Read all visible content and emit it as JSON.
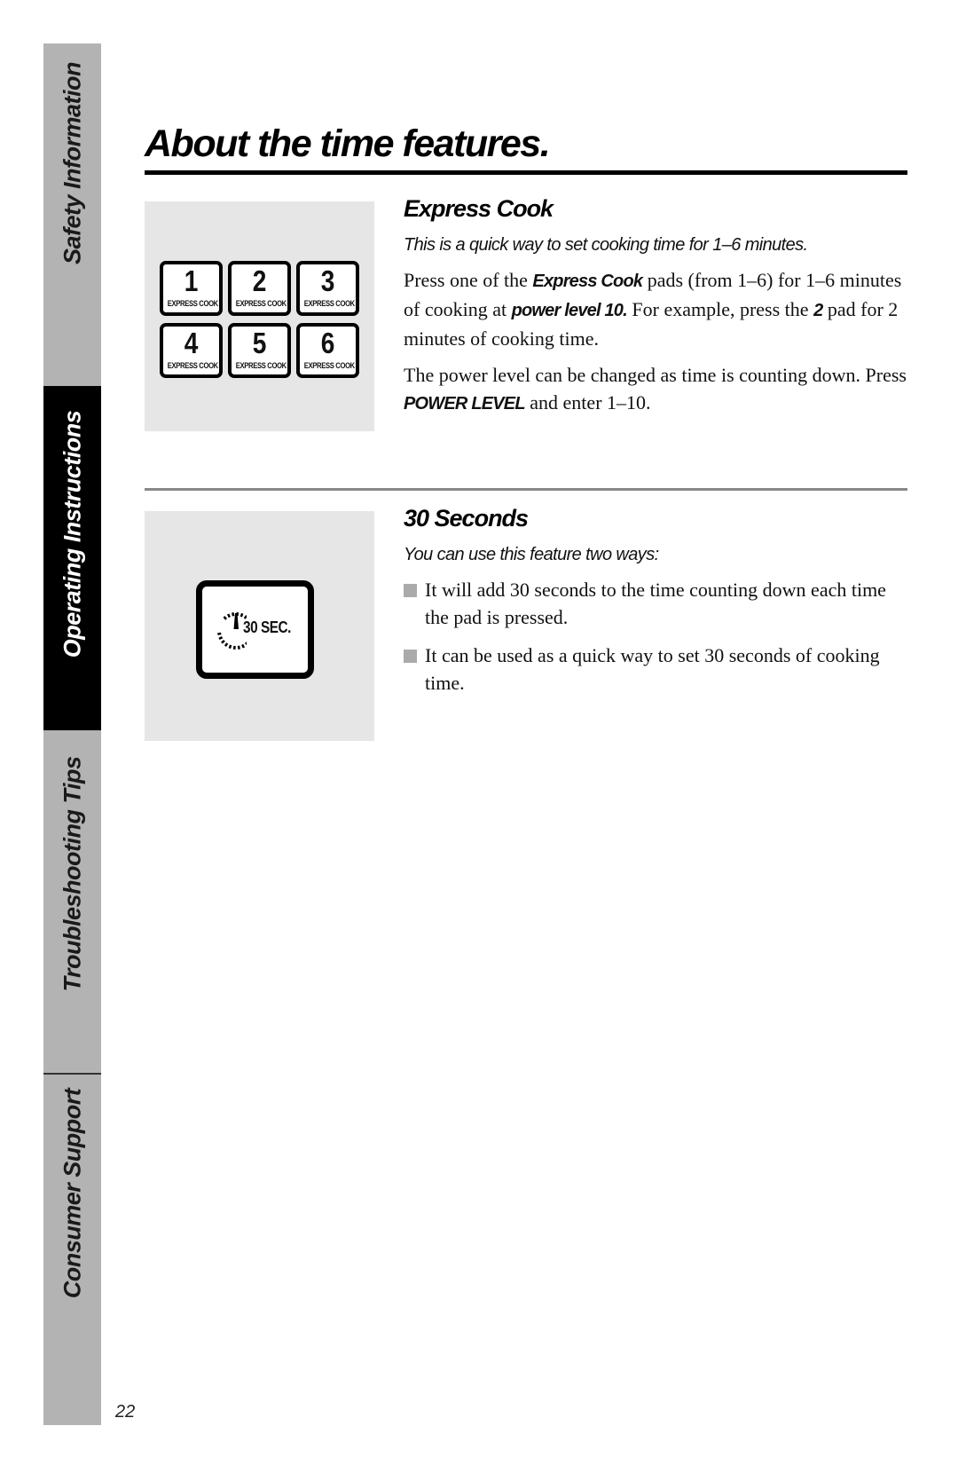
{
  "sidebar": {
    "tabs": [
      {
        "label": "Safety Information",
        "active": false
      },
      {
        "label": "Operating Instructions",
        "active": true
      },
      {
        "label": "Troubleshooting Tips",
        "active": false
      },
      {
        "label": "Consumer Support",
        "active": false
      }
    ]
  },
  "page": {
    "title": "About the time features.",
    "number": "22"
  },
  "express_cook": {
    "heading": "Express Cook",
    "lead": "This is a quick way to set cooking time for 1–6 minutes.",
    "para1": {
      "t1": "Press one of the ",
      "k1": "Express Cook",
      "t2": " pads (from 1–6) for 1–6 minutes of cooking at ",
      "k2": "power level 10.",
      "t3": " For example, press the ",
      "k3": "2",
      "t4": " pad for 2 minutes of cooking time."
    },
    "para2": {
      "t1": "The power level can be changed as time is counting down. Press ",
      "k1": "POWER LEVEL",
      "t2": " and enter 1–10."
    },
    "pads": [
      {
        "number": "1",
        "label": "EXPRESS COOK"
      },
      {
        "number": "2",
        "label": "EXPRESS COOK"
      },
      {
        "number": "3",
        "label": "EXPRESS COOK"
      },
      {
        "number": "4",
        "label": "EXPRESS COOK"
      },
      {
        "number": "5",
        "label": "EXPRESS COOK"
      },
      {
        "number": "6",
        "label": "EXPRESS COOK"
      }
    ]
  },
  "thirty_seconds": {
    "heading": "30 Seconds",
    "lead": "You can use this feature two ways:",
    "pad_label": "30 SEC.",
    "pad_icon": "timer-dial-icon",
    "bullets": [
      "It will add 30 seconds to the time counting down each time the pad is pressed.",
      "It can be used as a quick way to set 30 seconds of cooking time."
    ]
  }
}
